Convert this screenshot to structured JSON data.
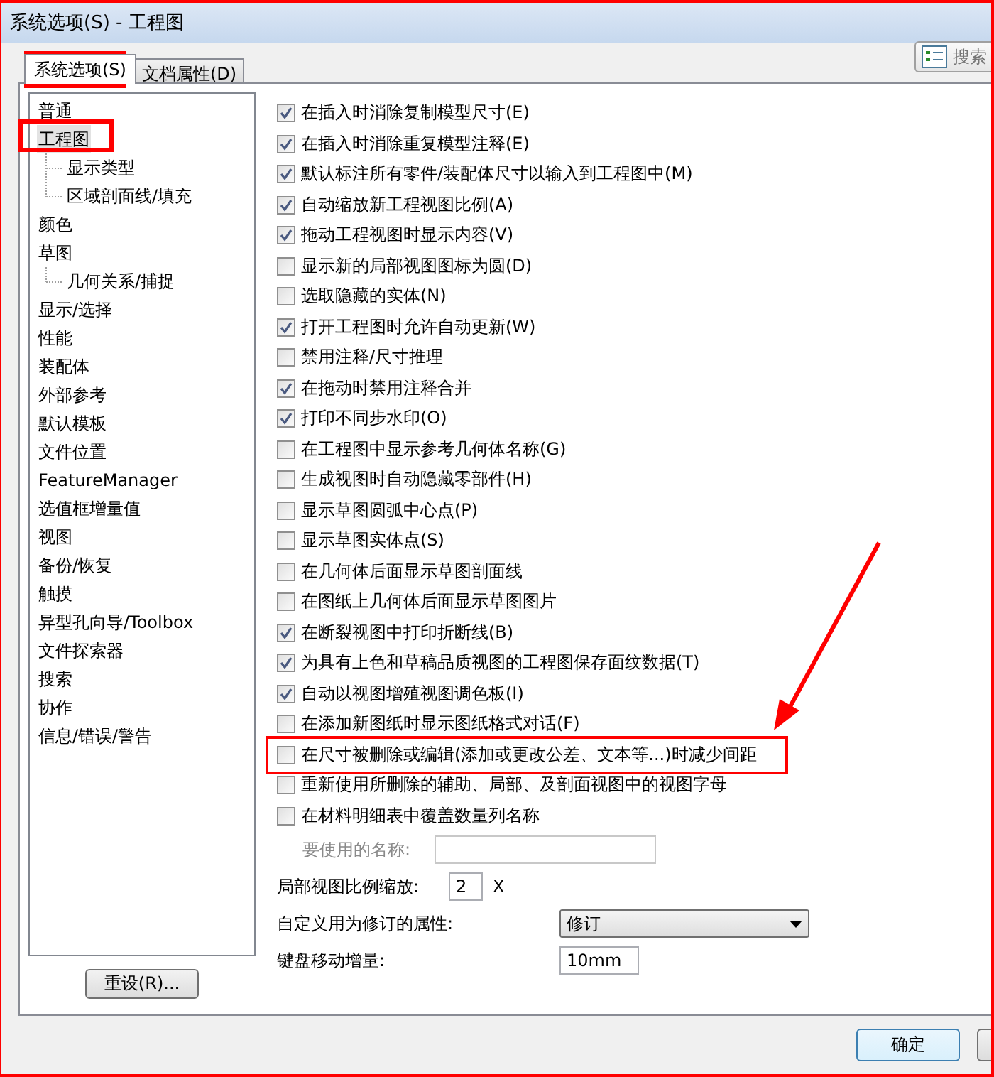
{
  "window": {
    "title": "系统选项(S) - 工程图"
  },
  "tabs": [
    {
      "label": "系统选项(S)",
      "selected": true
    },
    {
      "label": "文档属性(D)",
      "selected": false
    }
  ],
  "search_button": {
    "label": "搜索"
  },
  "tree": [
    {
      "label": "普通",
      "selected": false
    },
    {
      "label": "工程图",
      "selected": true,
      "children": [
        {
          "label": "显示类型",
          "selected": false
        },
        {
          "label": "区域剖面线/填充",
          "selected": false
        }
      ]
    },
    {
      "label": "颜色",
      "selected": false
    },
    {
      "label": "草图",
      "selected": false,
      "children": [
        {
          "label": "几何关系/捕捉",
          "selected": false
        }
      ]
    },
    {
      "label": "显示/选择",
      "selected": false
    },
    {
      "label": "性能",
      "selected": false
    },
    {
      "label": "装配体",
      "selected": false
    },
    {
      "label": "外部参考",
      "selected": false
    },
    {
      "label": "默认模板",
      "selected": false
    },
    {
      "label": "文件位置",
      "selected": false
    },
    {
      "label": "FeatureManager",
      "selected": false
    },
    {
      "label": "选值框增量值",
      "selected": false
    },
    {
      "label": "视图",
      "selected": false
    },
    {
      "label": "备份/恢复",
      "selected": false
    },
    {
      "label": "触摸",
      "selected": false
    },
    {
      "label": "异型孔向导/Toolbox",
      "selected": false
    },
    {
      "label": "文件探索器",
      "selected": false
    },
    {
      "label": "搜索",
      "selected": false
    },
    {
      "label": "协作",
      "selected": false
    },
    {
      "label": "信息/错误/警告",
      "selected": false
    }
  ],
  "reset_button": "重设(R)...",
  "options": [
    {
      "label": "在插入时消除复制模型尺寸(E)",
      "checked": true
    },
    {
      "label": "在插入时消除重复模型注释(E)",
      "checked": true
    },
    {
      "label": "默认标注所有零件/装配体尺寸以输入到工程图中(M)",
      "checked": true
    },
    {
      "label": "自动缩放新工程视图比例(A)",
      "checked": true
    },
    {
      "label": "拖动工程视图时显示内容(V)",
      "checked": true
    },
    {
      "label": "显示新的局部视图图标为圆(D)",
      "checked": false
    },
    {
      "label": "选取隐藏的实体(N)",
      "checked": false
    },
    {
      "label": "打开工程图时允许自动更新(W)",
      "checked": true
    },
    {
      "label": "禁用注释/尺寸推理",
      "checked": false
    },
    {
      "label": "在拖动时禁用注释合并",
      "checked": true
    },
    {
      "label": "打印不同步水印(O)",
      "checked": true
    },
    {
      "label": "在工程图中显示参考几何体名称(G)",
      "checked": false
    },
    {
      "label": "生成视图时自动隐藏零部件(H)",
      "checked": false
    },
    {
      "label": "显示草图圆弧中心点(P)",
      "checked": false
    },
    {
      "label": "显示草图实体点(S)",
      "checked": false
    },
    {
      "label": "在几何体后面显示草图剖面线",
      "checked": false
    },
    {
      "label": "在图纸上几何体后面显示草图图片",
      "checked": false
    },
    {
      "label": "在断裂视图中打印折断线(B)",
      "checked": true
    },
    {
      "label": "为具有上色和草稿品质视图的工程图保存面纹数据(T)",
      "checked": true
    },
    {
      "label": "自动以视图增殖视图调色板(I)",
      "checked": true
    },
    {
      "label": "在添加新图纸时显示图纸格式对话(F)",
      "checked": false
    },
    {
      "label": "在尺寸被删除或编辑(添加或更改公差、文本等...)时减少间距",
      "checked": false
    },
    {
      "label": "重新使用所删除的辅助、局部、及剖面视图中的视图字母",
      "checked": false
    },
    {
      "label": "在材料明细表中覆盖数量列名称",
      "checked": false
    }
  ],
  "fields": [
    {
      "kind": "sub-input",
      "label": "要使用的名称:",
      "disabled": true
    },
    {
      "kind": "number",
      "label": "局部视图比例缩放:",
      "value": "2",
      "suffix": "X",
      "disabled": false
    },
    {
      "kind": "dropdown",
      "label": "自定义用为修订的属性:",
      "value": "修订",
      "disabled": false
    },
    {
      "kind": "input",
      "label": "键盘移动增量:",
      "value": "10mm",
      "disabled": false
    }
  ],
  "buttons": [
    {
      "label": "确定",
      "default": true
    },
    {
      "default": false
    }
  ]
}
